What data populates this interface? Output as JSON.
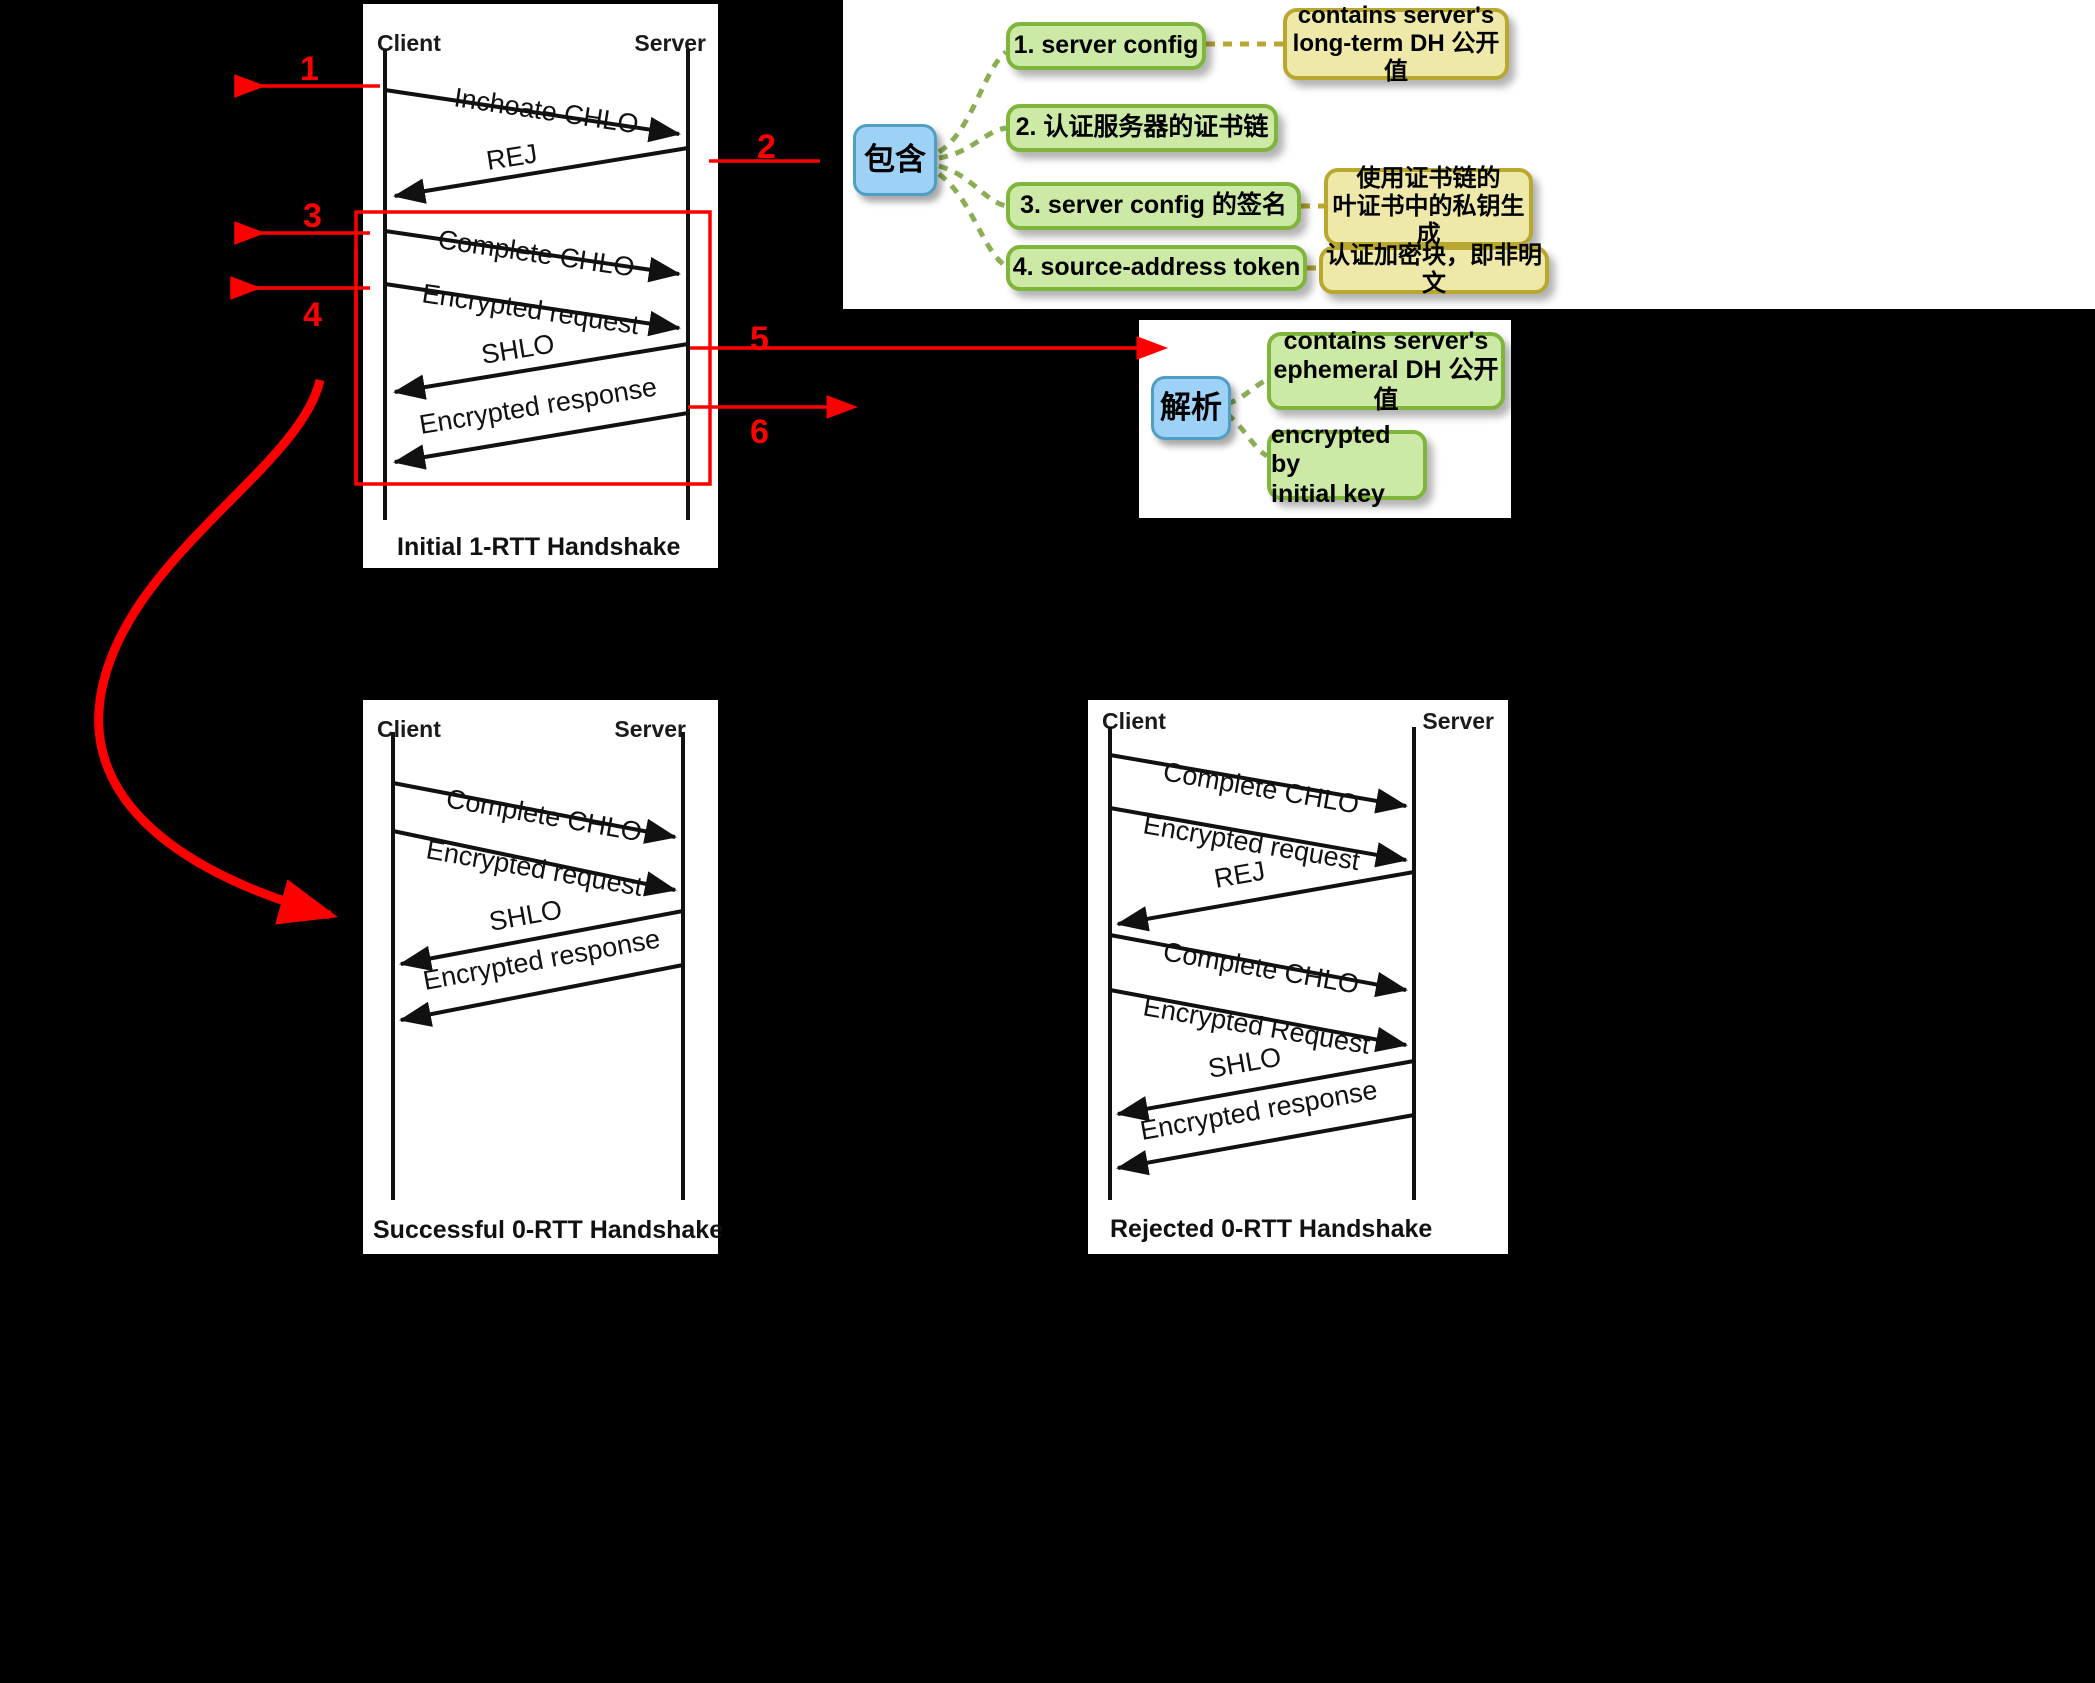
{
  "colors": {
    "red": "#ff0000",
    "green_fill": "#cce9a6",
    "green_border": "#7fb53a",
    "yellow_fill": "#eee9a8",
    "yellow_border": "#b9a830",
    "blue_fill": "#9dd1f5",
    "blue_border": "#4f9fc4",
    "background": "#000000",
    "panel": "#ffffff"
  },
  "diagrams": {
    "initial": {
      "title": "Initial 1-RTT Handshake",
      "client_label": "Client",
      "server_label": "Server",
      "messages": [
        "Inchoate CHLO",
        "REJ",
        "Complete CHLO",
        "Encrypted request",
        "SHLO",
        "Encrypted response"
      ]
    },
    "successful": {
      "title": "Successful 0-RTT Handshake",
      "client_label": "Client",
      "server_label": "Server",
      "messages": [
        "Complete CHLO",
        "Encrypted request",
        "SHLO",
        "Encrypted response"
      ]
    },
    "rejected": {
      "title": "Rejected 0-RTT Handshake",
      "client_label": "Client",
      "server_label": "Server",
      "messages": [
        "Complete CHLO",
        "Encrypted request",
        "REJ",
        "Complete CHLO",
        "Encrypted Request",
        "SHLO",
        "Encrypted response"
      ]
    }
  },
  "step_markers": [
    "1",
    "2",
    "3",
    "4",
    "5",
    "6"
  ],
  "mindmap_contains": {
    "root": "包含",
    "items": [
      {
        "label": "1. server config",
        "note": "contains server's\nlong-term DH 公开值"
      },
      {
        "label": "2. 认证服务器的证书链",
        "note": null
      },
      {
        "label": "3. server config 的签名",
        "note": "使用证书链的\n叶证书中的私钥生成"
      },
      {
        "label": "4. source-address token",
        "note": "认证加密块，即非明文"
      }
    ]
  },
  "mindmap_parse": {
    "root": "解析",
    "items": [
      {
        "label": "contains server's\nephemeral DH 公开值"
      },
      {
        "label": "encrypted by\ninitial key"
      }
    ]
  }
}
